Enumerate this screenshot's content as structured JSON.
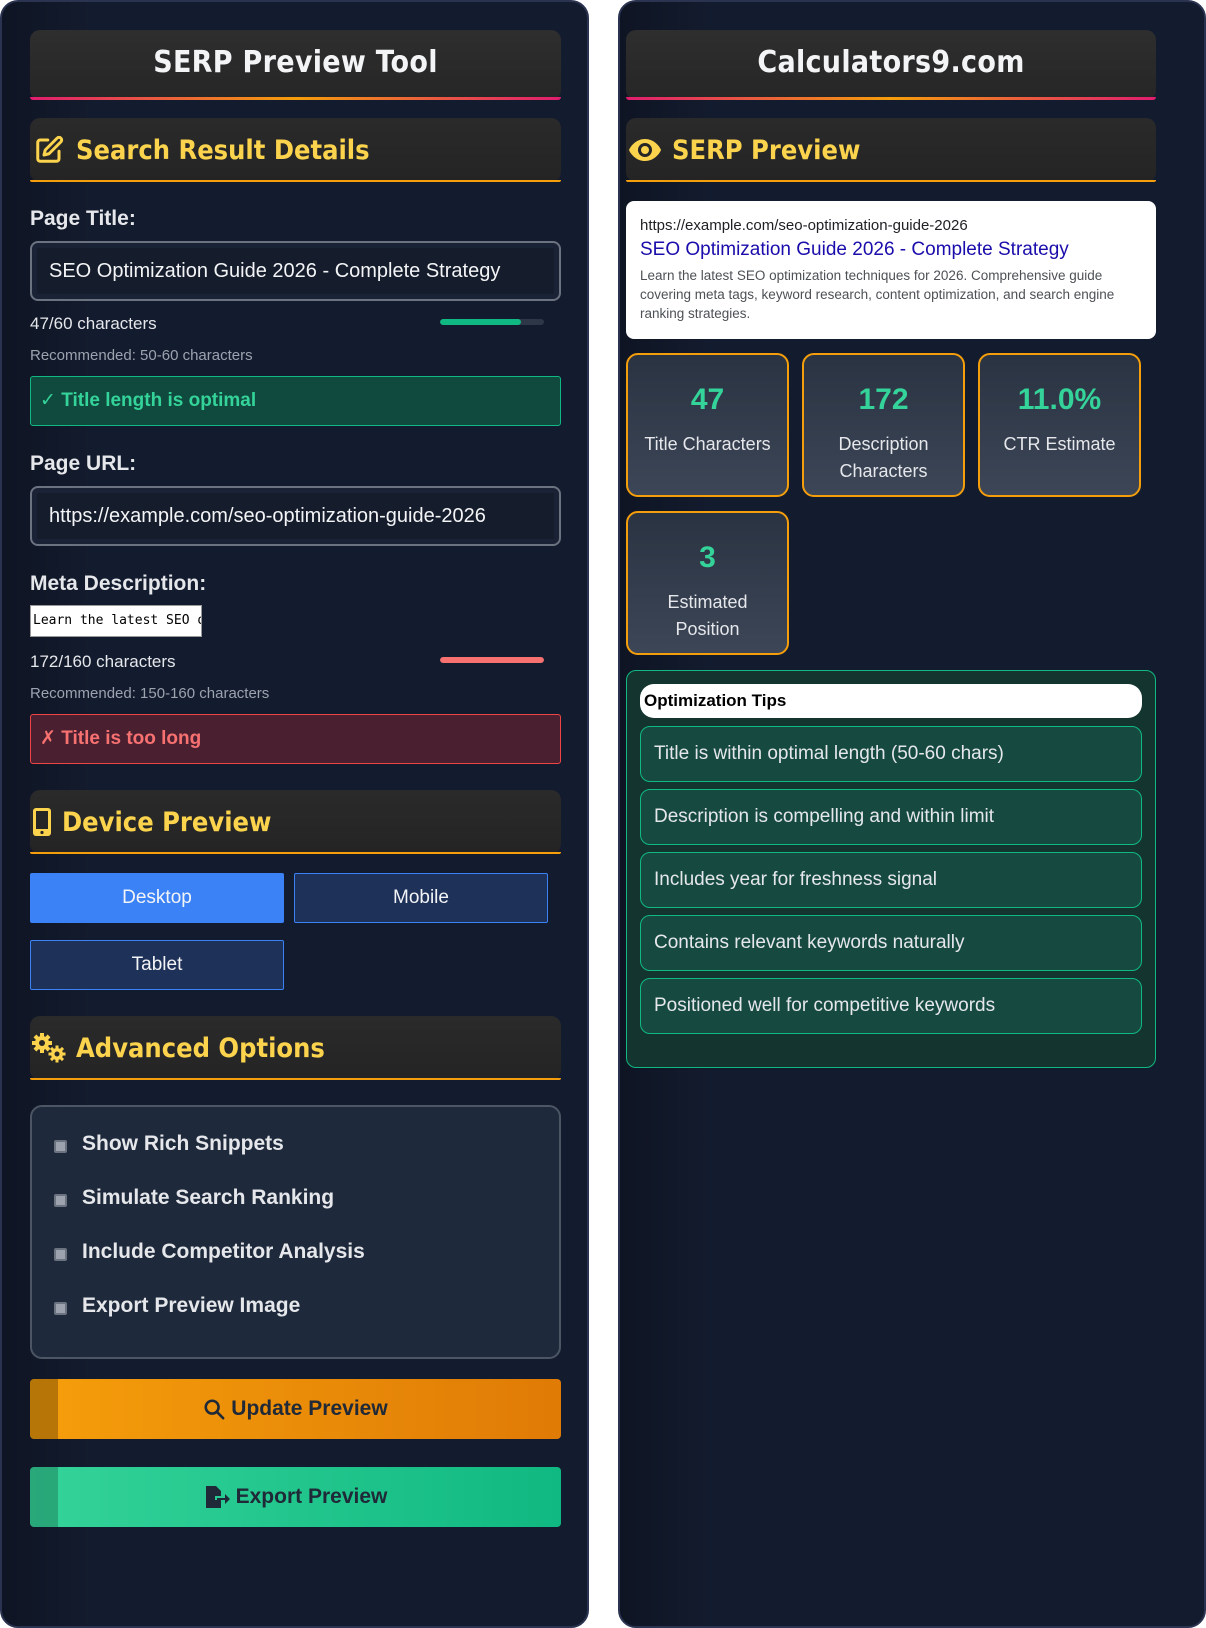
{
  "left": {
    "title": "SERP Preview Tool",
    "details_heading": "Search Result Details",
    "page_title_label": "Page Title:",
    "page_title_value": "SEO Optimization Guide 2026 - Complete Strategy",
    "title_count": "47/60 characters",
    "title_fill": 0.78,
    "title_recommended": "Recommended: 50-60 characters",
    "title_status": "✓ Title length is optimal",
    "url_label": "Page URL:",
    "url_value": "https://example.com/seo-optimization-guide-2026",
    "meta_label": "Meta Description:",
    "meta_value": "Learn the latest SEO o",
    "desc_count": "172/160 characters",
    "desc_fill": 1.0,
    "desc_recommended": "Recommended: 150-160 characters",
    "desc_status": "✗ Title is too long",
    "device_heading": "Device Preview",
    "devices": {
      "desktop": "Desktop",
      "mobile": "Mobile",
      "tablet": "Tablet"
    },
    "advanced_heading": "Advanced Options",
    "options": {
      "o1": "Show Rich Snippets",
      "o2": "Simulate Search Ranking",
      "o3": "Include Competitor Analysis",
      "o4": "Export Preview Image"
    },
    "update_button": "Update Preview",
    "export_button": "Export Preview"
  },
  "right": {
    "title": "Calculators9.com",
    "preview_heading": "SERP Preview",
    "serp": {
      "url": "https://example.com/seo-optimization-guide-2026",
      "title": "SEO Optimization Guide 2026 - Complete Strategy",
      "description": "Learn the latest SEO optimization techniques for 2026. Comprehensive guide covering meta tags, keyword research, content optimization, and search engine ranking strategies."
    },
    "stats": {
      "title_chars": {
        "value": "47",
        "label": "Title Characters"
      },
      "desc_chars": {
        "value": "172",
        "label": "Description Characters"
      },
      "ctr": {
        "value": "11.0%",
        "label": "CTR Estimate"
      },
      "position": {
        "value": "3",
        "label": "Estimated Position"
      }
    },
    "tips_heading": "Optimization Tips",
    "tips": {
      "t1": "Title is within optimal length (50-60 chars)",
      "t2": "Description is compelling and within limit",
      "t3": "Includes year for freshness signal",
      "t4": "Contains relevant keywords naturally",
      "t5": "Positioned well for competitive keywords"
    }
  },
  "colors": {
    "accent_gold": "#fcd34d",
    "success": "#10b981",
    "error": "#ef4444",
    "primary_blue": "#3b82f6",
    "orange": "#f59e0b"
  },
  "icons": {
    "details": "edit-icon",
    "preview": "eye-icon",
    "device": "mobile-icon",
    "advanced": "gears-icon",
    "update": "search-icon",
    "export": "file-export-icon"
  }
}
